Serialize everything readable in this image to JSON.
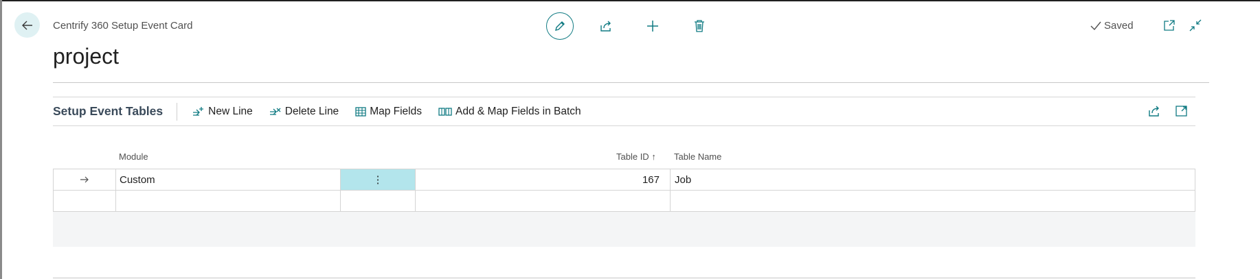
{
  "header": {
    "caption": "Centrify 360 Setup Event Card",
    "title": "project",
    "status": "Saved",
    "icons": [
      "back-arrow-icon",
      "pencil-icon",
      "share-icon",
      "plus-icon",
      "trash-icon",
      "check-icon",
      "open-new-window-icon",
      "collapse-icon"
    ]
  },
  "part": {
    "title": "Setup Event Tables",
    "actions": {
      "new_line": "New Line",
      "delete_line": "Delete Line",
      "map_fields": "Map Fields",
      "add_map_batch": "Add & Map Fields in Batch"
    }
  },
  "table": {
    "columns": {
      "module": "Module",
      "table_id": "Table ID",
      "table_id_sort": "↑",
      "table_name": "Table Name"
    },
    "rows": [
      {
        "module": "Custom",
        "menu": "⋮",
        "table_id": "167",
        "table_name": "Job"
      },
      {
        "module": "",
        "menu": "",
        "table_id": "",
        "table_name": ""
      }
    ]
  },
  "colors": {
    "accent": "#0f7a82",
    "selected_cell": "#b3e5ec",
    "back_button_bg": "#dff1f3"
  }
}
